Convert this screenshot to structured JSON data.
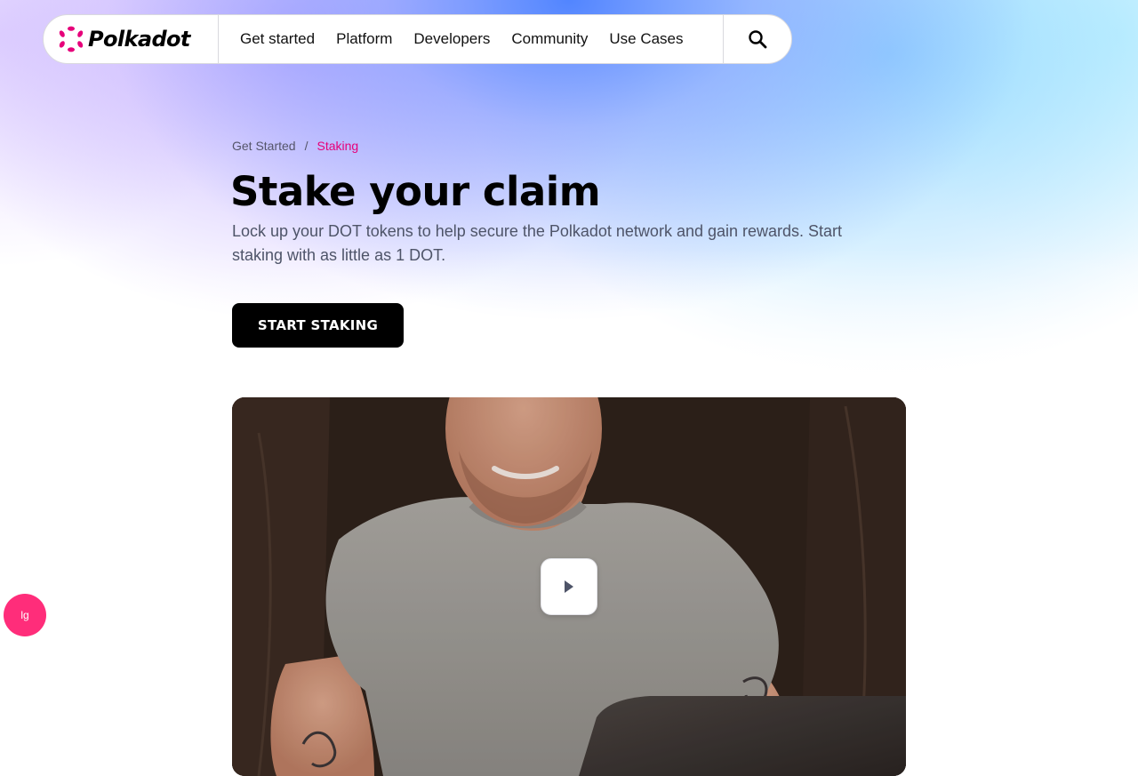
{
  "brand": {
    "name": "Polkadot",
    "accent": "#e6007a"
  },
  "nav": {
    "items": [
      "Get started",
      "Platform",
      "Developers",
      "Community",
      "Use Cases"
    ],
    "search_icon": "search-icon"
  },
  "breadcrumb": {
    "parent": "Get Started",
    "separator": "/",
    "current": "Staking"
  },
  "hero": {
    "title": "Stake your claim",
    "subtitle": "Lock up your DOT tokens to help secure the Polkadot network and gain rewards. Start staking with as little as 1 DOT.",
    "cta_label": "START STAKING"
  },
  "video": {
    "play_icon": "play-icon"
  },
  "floating_badge": {
    "label": "lg",
    "color": "#ff2d7a"
  }
}
